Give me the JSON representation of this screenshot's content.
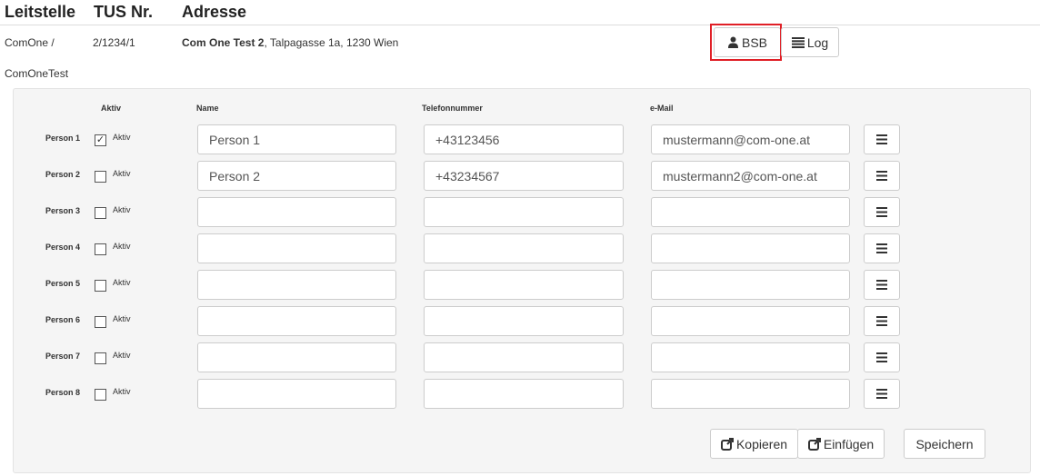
{
  "header": {
    "col1": "Leitstelle",
    "col2": "TUS Nr.",
    "col3": "Adresse"
  },
  "info": {
    "leitstelle_line1": "ComOne /",
    "leitstelle_line2": "ComOneTest",
    "tus_nr": "2/1234/1",
    "address_name": "Com One Test 2",
    "address_rest": ", Talpagasse 1a, 1230 Wien"
  },
  "toolbar": {
    "bsb_label": "BSB",
    "log_label": "Log"
  },
  "form": {
    "columns": {
      "aktiv": "Aktiv",
      "name": "Name",
      "telefon": "Telefonnummer",
      "email": "e-Mail"
    },
    "aktiv_label": "Aktiv",
    "persons": [
      {
        "label": "Person 1",
        "active": true,
        "name": "Person 1",
        "phone": "+43123456",
        "email": "mustermann@com-one.at"
      },
      {
        "label": "Person 2",
        "active": false,
        "name": "Person 2",
        "phone": "+43234567",
        "email": "mustermann2@com-one.at"
      },
      {
        "label": "Person 3",
        "active": false,
        "name": "",
        "phone": "",
        "email": ""
      },
      {
        "label": "Person 4",
        "active": false,
        "name": "",
        "phone": "",
        "email": ""
      },
      {
        "label": "Person 5",
        "active": false,
        "name": "",
        "phone": "",
        "email": ""
      },
      {
        "label": "Person 6",
        "active": false,
        "name": "",
        "phone": "",
        "email": ""
      },
      {
        "label": "Person 7",
        "active": false,
        "name": "",
        "phone": "",
        "email": ""
      },
      {
        "label": "Person 8",
        "active": false,
        "name": "",
        "phone": "",
        "email": ""
      }
    ]
  },
  "actions": {
    "copy_label": "Kopieren",
    "paste_label": "Einfügen",
    "save_label": "Speichern"
  },
  "colors": {
    "highlight": "#e01f26",
    "panel_bg": "#f5f5f5",
    "border": "#cccccc"
  },
  "icons": {
    "bsb": "user-icon",
    "log": "list-icon",
    "row_menu": "menu-icon",
    "copy": "external-link-icon",
    "paste": "external-link-icon"
  }
}
